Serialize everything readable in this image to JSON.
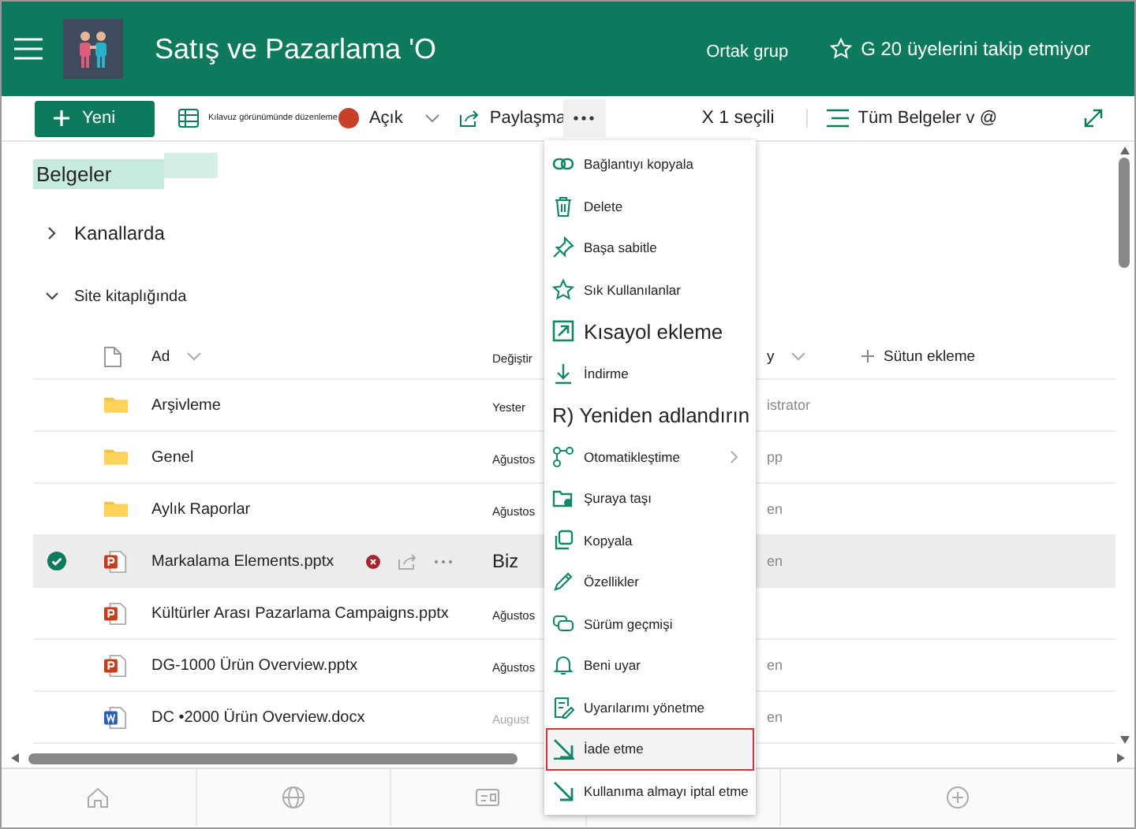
{
  "header": {
    "title": "Satış ve Pazarlama 'O",
    "group_type": "Ortak grup",
    "follow": "G 20 üyelerini takip etmiyor"
  },
  "command_bar": {
    "new": "Yeni",
    "grid_edit": "Kılavuz görünümünde düzenleme",
    "open": "Açık",
    "share": "Paylaşma",
    "selection": "X 1 seçili",
    "view": "Tüm Belgeler v @"
  },
  "library": {
    "title": "Belgeler",
    "sections": [
      {
        "label": "Kanallarda",
        "expanded": false
      },
      {
        "label": "Site kitaplığında",
        "expanded": true
      }
    ]
  },
  "table": {
    "columns": [
      "Ad",
      "Değiştir",
      "y",
      "Sütun ekleme"
    ],
    "rows": [
      {
        "kind": "folder",
        "name": "Arşivleme",
        "modified": "Yester",
        "modified_by": "istrator",
        "selected": false
      },
      {
        "kind": "folder",
        "name": "Genel",
        "modified": "Ağustos",
        "modified_by": "pp",
        "selected": false
      },
      {
        "kind": "folder",
        "name": "Aylık Raporlar",
        "modified": "Ağustos",
        "modified_by": "en",
        "selected": false
      },
      {
        "kind": "pptx",
        "name": "Markalama Elements.pptx",
        "modified": "Biz",
        "modified_by": "en",
        "selected": true
      },
      {
        "kind": "pptx",
        "name": "Kültürler Arası Pazarlama Campaigns.pptx",
        "modified": "Ağustos",
        "selected": false
      },
      {
        "kind": "pptx",
        "name": "DG-1000 Ürün Overview.pptx",
        "modified": "Ağustos",
        "modified_by": "en",
        "selected": false
      },
      {
        "kind": "docx",
        "name": "DC •2000 Ürün Overview.docx",
        "modified": "August",
        "modified_by": "en",
        "selected": false,
        "dim": true
      }
    ]
  },
  "context_menu": {
    "items": [
      {
        "kind": "normal",
        "label": "Bağlantıyı kopyala",
        "selected": false
      },
      {
        "kind": "normal",
        "label": "Delete",
        "selected": false
      },
      {
        "kind": "normal",
        "label": "Başa sabitle",
        "selected": false
      },
      {
        "kind": "normal",
        "label": "Sık Kullanılanlar",
        "selected": false
      },
      {
        "kind": "large",
        "label": "Kısayol ekleme",
        "selected": false
      },
      {
        "kind": "normal",
        "label": "İndirme",
        "selected": false
      },
      {
        "kind": "large-plain",
        "label": "R) Yeniden adlandırın",
        "selected": false
      },
      {
        "kind": "submenu",
        "label": "Otomatikleştime",
        "selected": false
      },
      {
        "kind": "normal",
        "label": "Şuraya taşı",
        "selected": false
      },
      {
        "kind": "normal",
        "label": "Kopyala",
        "selected": false
      },
      {
        "kind": "normal",
        "label": "Özellikler",
        "selected": false
      },
      {
        "kind": "normal",
        "label": "Sürüm geçmişi",
        "selected": false
      },
      {
        "kind": "normal",
        "label": "Beni uyar",
        "selected": false
      },
      {
        "kind": "normal",
        "label": "Uyarılarımı yönetme",
        "selected": false
      },
      {
        "kind": "normal",
        "label": "İade etme",
        "selected": true
      },
      {
        "kind": "normal",
        "label": "Kullanıma almayı iptal etme",
        "selected": false
      }
    ]
  }
}
